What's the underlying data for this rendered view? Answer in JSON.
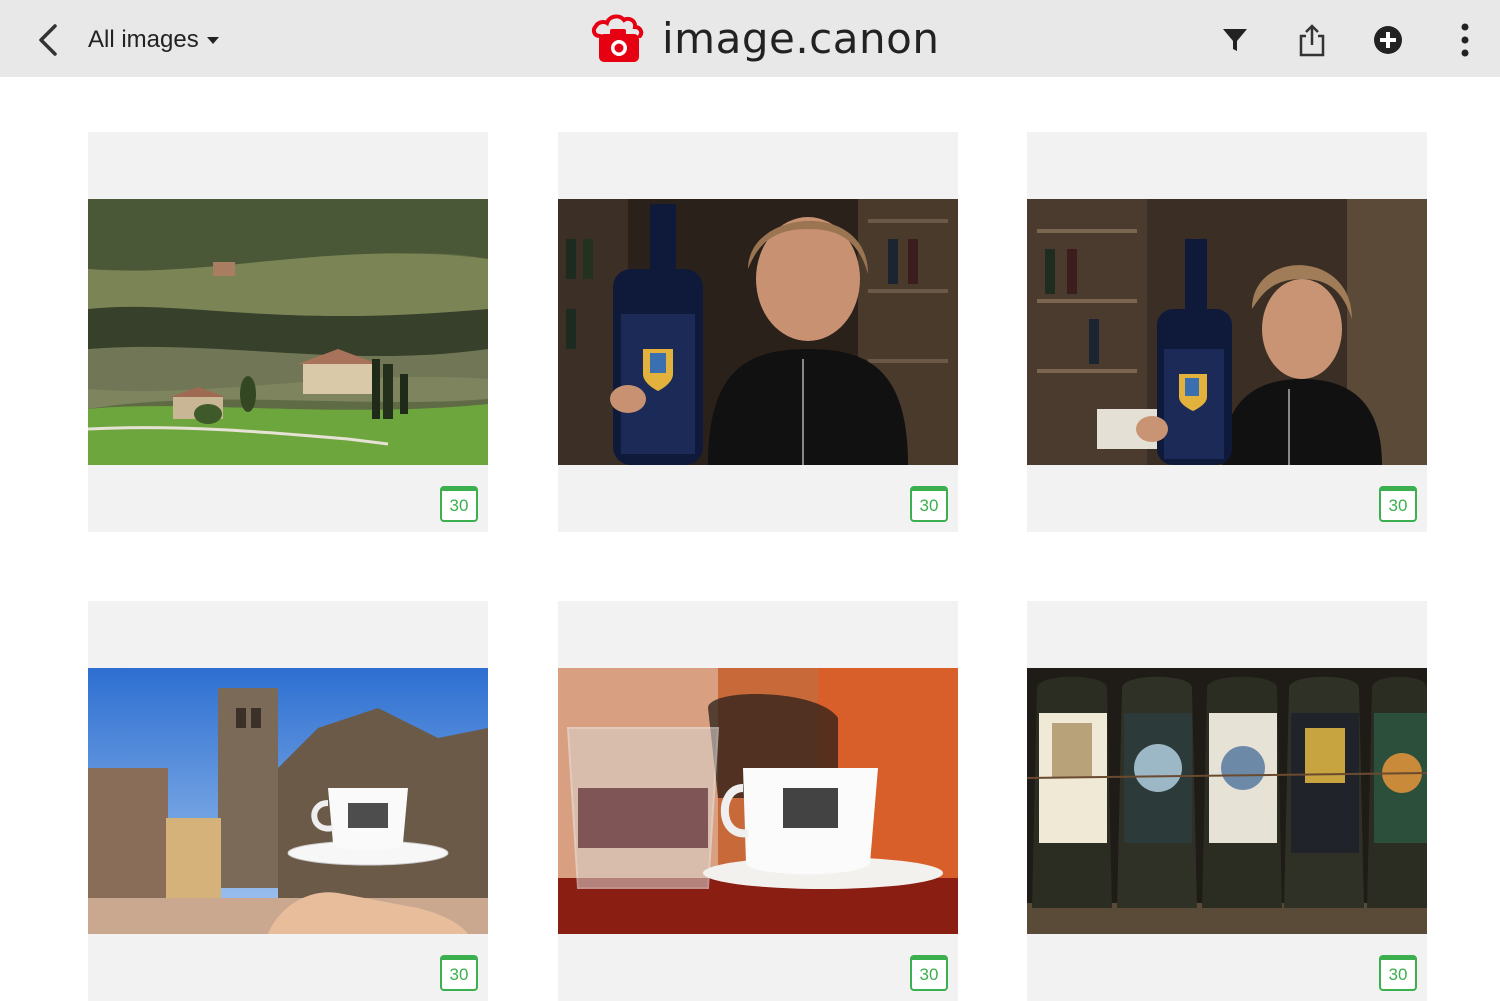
{
  "header": {
    "back_icon": "chevron-left-icon",
    "album_label": "All images",
    "brand_name": "image.canon",
    "brand_color": "#e60012",
    "tools": [
      "filter-icon",
      "share-icon",
      "add-circle-icon",
      "more-vertical-icon"
    ]
  },
  "gallery": {
    "badge_color": "#3caf4e",
    "items": [
      {
        "badge": "30"
      },
      {
        "badge": "30"
      },
      {
        "badge": "30"
      },
      {
        "badge": "30"
      },
      {
        "badge": "30"
      },
      {
        "badge": "30"
      }
    ]
  }
}
